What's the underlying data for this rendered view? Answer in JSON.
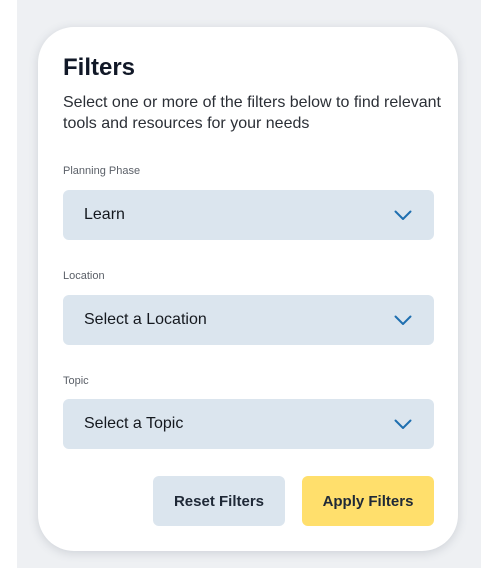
{
  "filters": {
    "title": "Filters",
    "description": "Select one or more of the filters below to find relevant tools and resources for your needs",
    "fields": [
      {
        "label": "Planning Phase",
        "value": "Learn"
      },
      {
        "label": "Location",
        "value": "Select a Location"
      },
      {
        "label": "Topic",
        "value": "Select a Topic"
      }
    ],
    "buttons": {
      "reset_label": "Reset Filters",
      "apply_label": "Apply Filters"
    }
  },
  "icons": {
    "select_chevron": "chevron-down-icon"
  },
  "colors": {
    "select_background": "#dbe5ee",
    "chevron": "#1f6fb0",
    "apply_button": "#ffdf6c",
    "reset_button": "#dbe5ee",
    "card_background": "#ffffff",
    "backdrop": "#eef0f3"
  }
}
